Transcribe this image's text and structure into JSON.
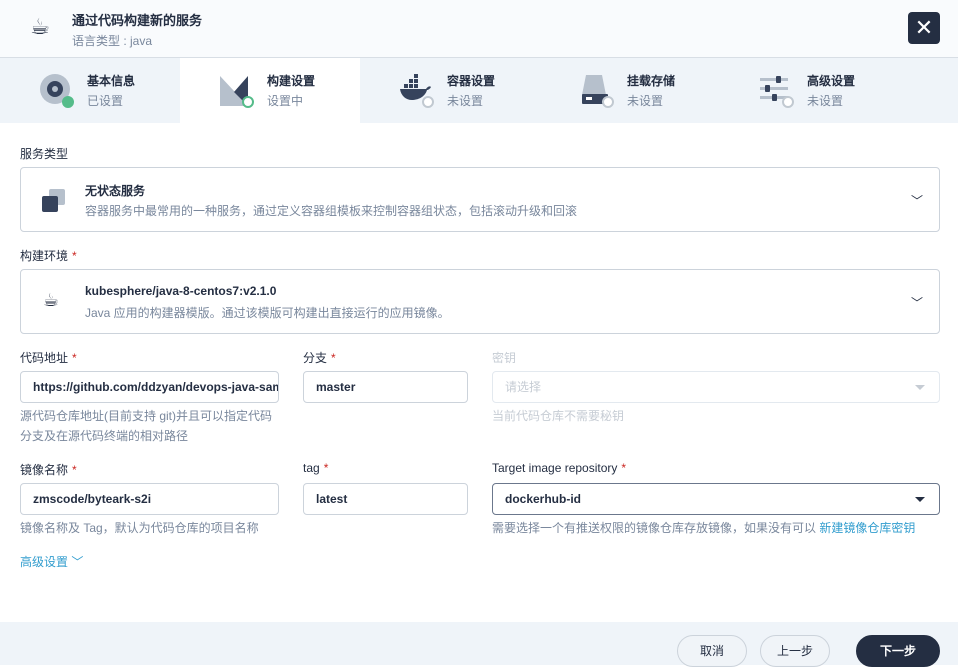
{
  "header": {
    "title": "通过代码构建新的服务",
    "subtitle": "语言类型 : java",
    "close": "✕"
  },
  "tabs": [
    {
      "title": "基本信息",
      "status": "已设置"
    },
    {
      "title": "构建设置",
      "status": "设置中"
    },
    {
      "title": "容器设置",
      "status": "未设置"
    },
    {
      "title": "挂载存储",
      "status": "未设置"
    },
    {
      "title": "高级设置",
      "status": "未设置"
    }
  ],
  "form": {
    "service_type": {
      "label": "服务类型",
      "title": "无状态服务",
      "desc": "容器服务中最常用的一种服务，通过定义容器组模板来控制容器组状态，包括滚动升级和回滚"
    },
    "build_env": {
      "label": "构建环境",
      "required": "*",
      "title": "kubesphere/java-8-centos7:v2.1.0",
      "desc": "Java 应用的构建器模版。通过该模版可构建出直接运行的应用镜像。"
    },
    "code_url": {
      "label": "代码地址",
      "required": "*",
      "value": "https://github.com/ddzyan/devops-java-sample",
      "hint1": "源代码仓库地址(目前支持 git)并且可以指定代码",
      "hint2": "分支及在源代码终端的相对路径"
    },
    "branch": {
      "label": "分支",
      "required": "*",
      "value": "master"
    },
    "secret": {
      "label": "密钥",
      "placeholder": "请选择",
      "hint": "当前代码仓库不需要秘钥"
    },
    "image_name": {
      "label": "镜像名称",
      "required": "*",
      "value": "zmscode/byteark-s2i",
      "hint": "镜像名称及 Tag，默认为代码仓库的项目名称"
    },
    "tag": {
      "label": "tag",
      "required": "*",
      "value": "latest"
    },
    "target_repo": {
      "label": "Target image repository",
      "required": "*",
      "value": "dockerhub-id",
      "hint": "需要选择一个有推送权限的镜像仓库存放镜像，如果没有可以 ",
      "link": "新建镜像仓库密钥"
    },
    "advanced": "高级设置"
  },
  "footer": {
    "cancel": "取消",
    "prev": "上一步",
    "next": "下一步"
  }
}
